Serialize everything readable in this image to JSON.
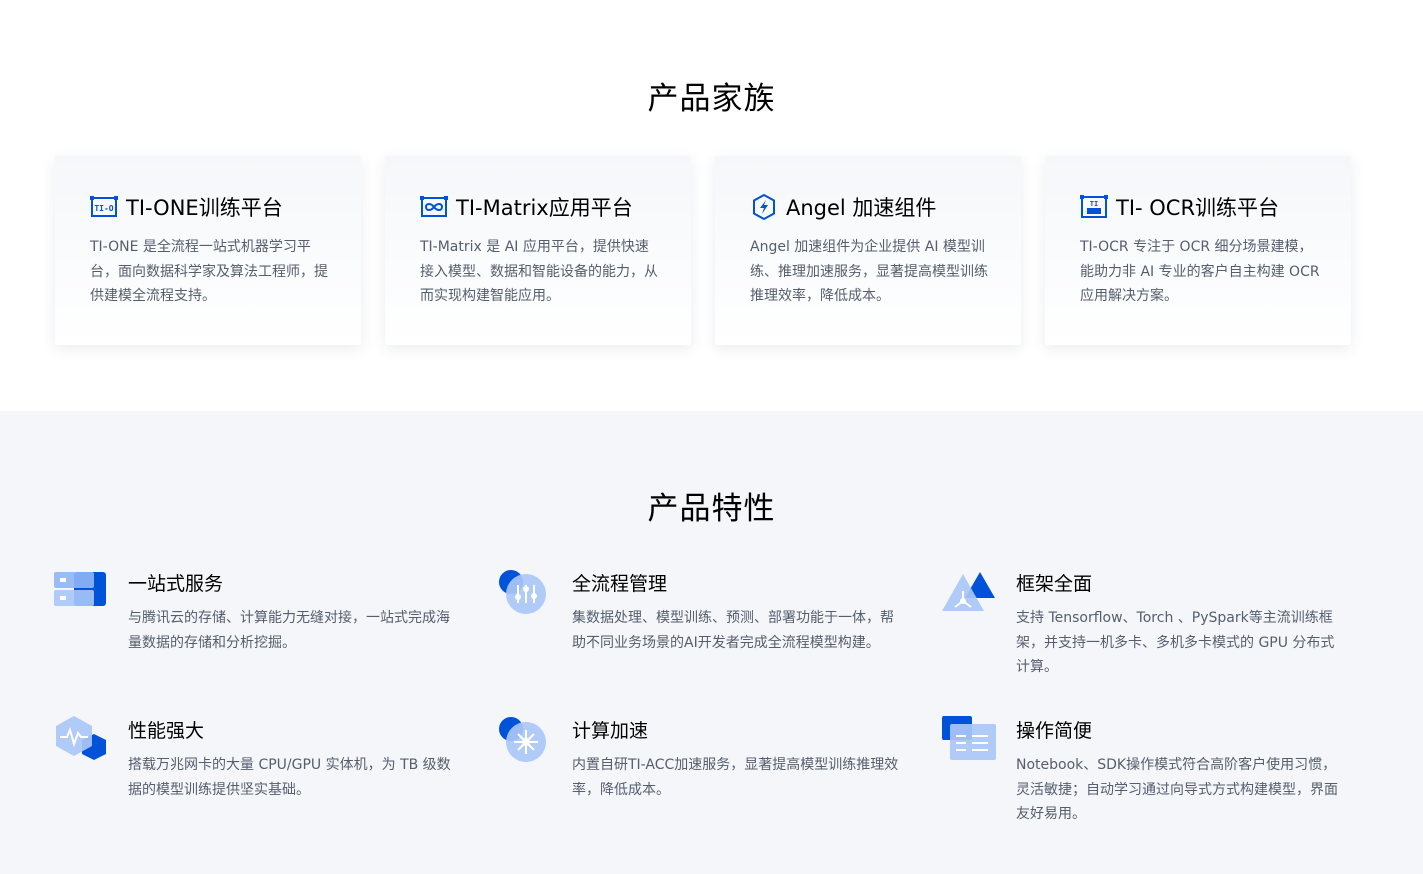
{
  "family": {
    "title": "产品家族",
    "cards": [
      {
        "icon": "ti-one-logo-icon",
        "title": "TI-ONE训练平台",
        "desc": "TI-ONE 是全流程一站式机器学习平台，面向数据科学家及算法工程师，提供建模全流程支持。"
      },
      {
        "icon": "ti-matrix-logo-icon",
        "title": "TI-Matrix应用平台",
        "desc": "TI-Matrix 是 AI 应用平台，提供快速接入模型、数据和智能设备的能力，从而实现构建智能应用。"
      },
      {
        "icon": "angel-lightning-shield-icon",
        "title": "Angel 加速组件",
        "desc": "Angel 加速组件为企业提供 AI 模型训练、推理加速服务，显著提高模型训练推理效率，降低成本。"
      },
      {
        "icon": "ti-ocr-logo-icon",
        "title": "TI- OCR训练平台",
        "desc": "TI-OCR 专注于 OCR 细分场景建模，能助力非 AI 专业的客户自主构建 OCR 应用解决方案。"
      }
    ]
  },
  "features": {
    "title": "产品特性",
    "items": [
      {
        "icon": "one-stop-service-icon",
        "title": "一站式服务",
        "desc": "与腾讯云的存储、计算能力无缝对接，一站式完成海量数据的存储和分析挖掘。"
      },
      {
        "icon": "process-management-icon",
        "title": "全流程管理",
        "desc": "集数据处理、模型训练、预测、部署功能于一体，帮助不同业务场景的AI开发者完成全流程模型构建。"
      },
      {
        "icon": "framework-icon",
        "title": "框架全面",
        "desc": "支持 Tensorflow、Torch 、PySpark等主流训练框架，并支持一机多卡、多机多卡模式的 GPU 分布式计算。"
      },
      {
        "icon": "performance-icon",
        "title": "性能强大",
        "desc": "搭载万兆网卡的大量 CPU/GPU 实体机，为 TB 级数据的模型训练提供坚实基础。"
      },
      {
        "icon": "compute-acceleration-icon",
        "title": "计算加速",
        "desc": "内置自研TI-ACC加速服务，显著提高模型训练推理效率，降低成本。"
      },
      {
        "icon": "easy-operation-icon",
        "title": "操作简便",
        "desc": "Notebook、SDK操作模式符合高阶客户使用习惯，灵活敏捷；自动学习通过向导式方式构建模型，界面友好易用。"
      }
    ]
  },
  "colors": {
    "brand_blue": "#0052d9",
    "light_blue": "#8fb6f5",
    "text_gray": "#555e6e",
    "section_bg": "#f4f6f9"
  }
}
